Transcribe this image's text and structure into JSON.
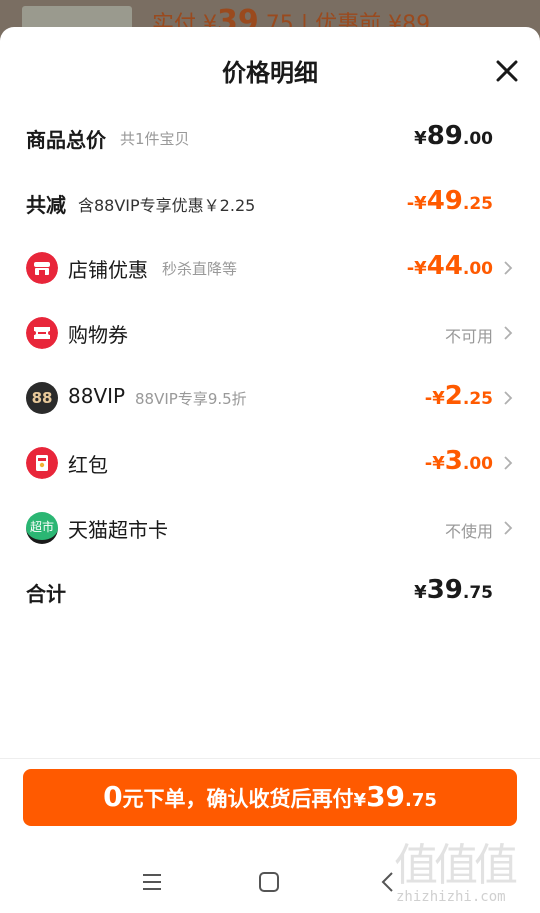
{
  "backdrop": {
    "text_prefix": "实付 ¥",
    "text_int": "39",
    "text_dec": ".75",
    "text_suffix": " | 优惠前 ¥89"
  },
  "sheet": {
    "title": "价格明细"
  },
  "rows": [
    {
      "label": "商品总价",
      "sub": "共1件宝贝",
      "amount": {
        "cur": "¥",
        "int": "89",
        "dec": ".00"
      }
    },
    {
      "label": "共减",
      "sub": "含88VIP专享优惠￥2.25",
      "amount": {
        "cur": "-¥",
        "int": "49",
        "dec": ".25"
      }
    },
    {
      "label": "店铺优惠",
      "sub": "秒杀直降等",
      "amount": {
        "cur": "-¥",
        "int": "44",
        "dec": ".00"
      },
      "icon": "store-icon"
    },
    {
      "label": "购物券",
      "sub": "",
      "status": "不可用",
      "icon": "coupon-icon"
    },
    {
      "label": "88VIP",
      "sub": "88VIP专享9.5折",
      "amount": {
        "cur": "-¥",
        "int": "2",
        "dec": ".25"
      },
      "icon": "88vip-icon",
      "icon_text": "88"
    },
    {
      "label": "红包",
      "sub": "",
      "amount": {
        "cur": "-¥",
        "int": "3",
        "dec": ".00"
      },
      "icon": "red-packet-icon"
    },
    {
      "label": "天猫超市卡",
      "sub": "",
      "status": "不使用",
      "icon": "tmall-supermarket-card-icon",
      "icon_text": "超市"
    },
    {
      "label": "合计",
      "sub": "",
      "amount": {
        "cur": "¥",
        "int": "39",
        "dec": ".75"
      }
    }
  ],
  "pay_button": {
    "int": "0",
    "text": "元下单，确认收货后再付",
    "cur": "¥",
    "amount_int": "39",
    "amount_dec": ".75"
  },
  "watermark": {
    "text": "值值值",
    "url": "zhizhizhi.com"
  },
  "colors": {
    "accent": "#ff5a00",
    "badge_red": "#e8263a",
    "vip_dark": "#2b2b2b",
    "market_green": "#2bb673"
  }
}
